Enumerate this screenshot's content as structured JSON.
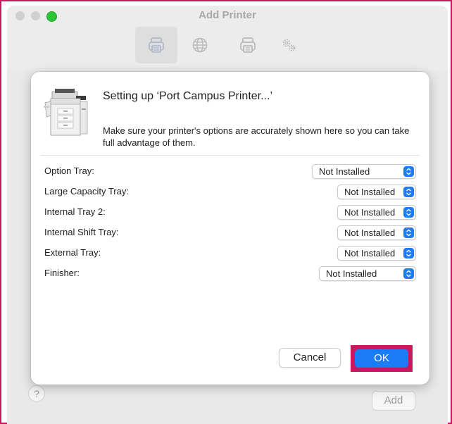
{
  "window": {
    "title": "Add Printer",
    "toolbar": [
      {
        "name": "default-printers",
        "icon": "printer-icon"
      },
      {
        "name": "ip",
        "icon": "globe-icon"
      },
      {
        "name": "windows",
        "icon": "printer-alt-icon"
      },
      {
        "name": "advanced",
        "icon": "gears-icon"
      }
    ],
    "help_label": "?",
    "add_label": "Add"
  },
  "sheet": {
    "title": "Setting up ‘Port Campus Printer...’",
    "description": "Make sure your printer's options are accurately shown here so you can take full advantage of them.",
    "options": [
      {
        "label": "Option Tray:",
        "value": "Not Installed"
      },
      {
        "label": "Large Capacity Tray:",
        "value": "Not Installed"
      },
      {
        "label": "Internal Tray 2:",
        "value": "Not Installed"
      },
      {
        "label": "Internal Shift Tray:",
        "value": "Not Installed"
      },
      {
        "label": "External Tray:",
        "value": "Not Installed"
      },
      {
        "label": "Finisher:",
        "value": "Not Installed"
      }
    ],
    "cancel_label": "Cancel",
    "ok_label": "OK"
  },
  "colors": {
    "accent": "#1a7cf7",
    "highlight": "#c8195e",
    "traffic_green": "#2ec438"
  }
}
